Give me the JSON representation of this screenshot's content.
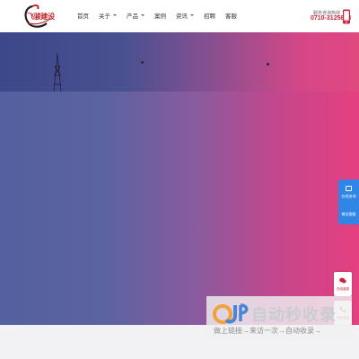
{
  "header": {
    "logo_text": "飞骏建设",
    "nav": [
      {
        "label": "首页",
        "has_dropdown": false
      },
      {
        "label": "关于",
        "has_dropdown": true
      },
      {
        "label": "产品",
        "has_dropdown": true
      },
      {
        "label": "案例",
        "has_dropdown": false
      },
      {
        "label": "资讯",
        "has_dropdown": true
      },
      {
        "label": "招聘",
        "has_dropdown": false
      },
      {
        "label": "客服",
        "has_dropdown": false
      }
    ],
    "phone_label": "服务咨询热线",
    "phone_number": "0710-3125888",
    "phone_icon": "mobile-phone-icon"
  },
  "side_float": {
    "items": [
      {
        "label": "在线咨询",
        "icon": "chat-icon"
      },
      {
        "label": "微信客服",
        "icon": "wechat-icon"
      }
    ]
  },
  "float_buttons": [
    {
      "label": "在线客服",
      "icon": "wechat-icon"
    },
    {
      "label": "咨询电话",
      "icon": "phone-icon"
    }
  ],
  "watermark": {
    "title": "自动秒收录",
    "subtitle": "做上链接→来访一次→自动收录→"
  },
  "colors": {
    "accent": "#d0203a",
    "side_float": "#2f86e6",
    "banner_left": "#54609f",
    "banner_right": "#e5407f"
  }
}
